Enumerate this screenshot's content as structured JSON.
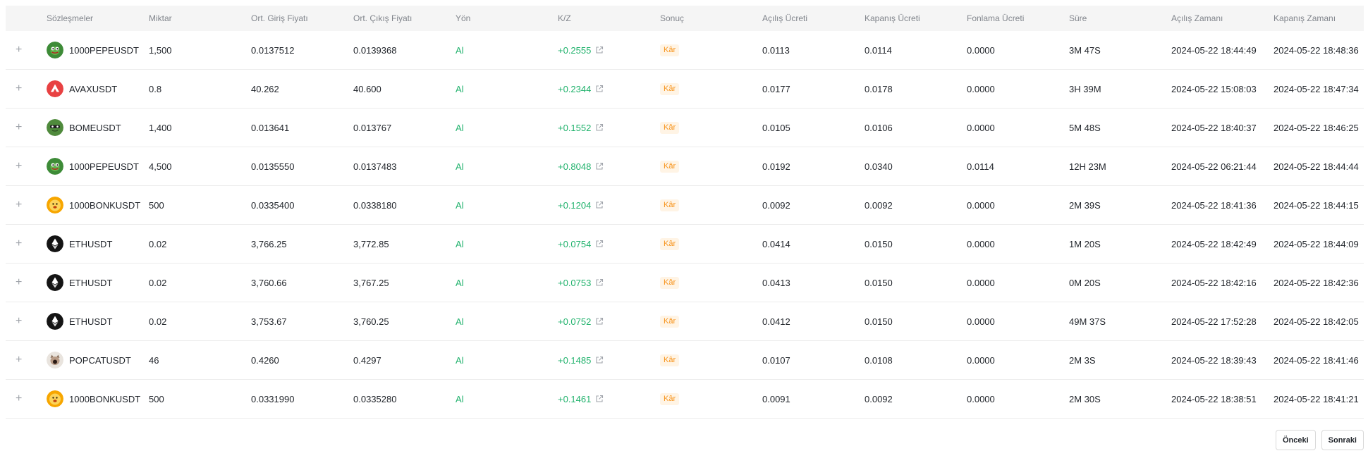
{
  "table": {
    "headers": {
      "symbol": "Sözleşmeler",
      "qty": "Miktar",
      "entry": "Ort. Giriş Fiyatı",
      "exit": "Ort. Çıkış Fiyatı",
      "side": "Yön",
      "pnl": "K/Z",
      "result": "Sonuç",
      "open_fee": "Açılış Ücreti",
      "close_fee": "Kapanış Ücreti",
      "funding_fee": "Fonlama Ücreti",
      "duration": "Süre",
      "open_time": "Açılış Zamanı",
      "close_time": "Kapanış Zamanı"
    },
    "expand_glyph": "+",
    "rows": [
      {
        "coin_icon": "pepe-coin-icon",
        "symbol": "1000PEPEUSDT",
        "qty": "1,500",
        "entry": "0.0137512",
        "exit": "0.0139368",
        "side": "Al",
        "pnl": "+0.2555",
        "result": "Kâr",
        "open_fee": "0.0113",
        "close_fee": "0.0114",
        "funding_fee": "0.0000",
        "duration": "3M 47S",
        "open_time": "2024-05-22 18:44:49",
        "close_time": "2024-05-22 18:48:36"
      },
      {
        "coin_icon": "avax-coin-icon",
        "symbol": "AVAXUSDT",
        "qty": "0.8",
        "entry": "40.262",
        "exit": "40.600",
        "side": "Al",
        "pnl": "+0.2344",
        "result": "Kâr",
        "open_fee": "0.0177",
        "close_fee": "0.0178",
        "funding_fee": "0.0000",
        "duration": "3H 39M",
        "open_time": "2024-05-22 15:08:03",
        "close_time": "2024-05-22 18:47:34"
      },
      {
        "coin_icon": "bome-coin-icon",
        "symbol": "BOMEUSDT",
        "qty": "1,400",
        "entry": "0.013641",
        "exit": "0.013767",
        "side": "Al",
        "pnl": "+0.1552",
        "result": "Kâr",
        "open_fee": "0.0105",
        "close_fee": "0.0106",
        "funding_fee": "0.0000",
        "duration": "5M 48S",
        "open_time": "2024-05-22 18:40:37",
        "close_time": "2024-05-22 18:46:25"
      },
      {
        "coin_icon": "pepe-coin-icon",
        "symbol": "1000PEPEUSDT",
        "qty": "4,500",
        "entry": "0.0135550",
        "exit": "0.0137483",
        "side": "Al",
        "pnl": "+0.8048",
        "result": "Kâr",
        "open_fee": "0.0192",
        "close_fee": "0.0340",
        "funding_fee": "0.0114",
        "duration": "12H 23M",
        "open_time": "2024-05-22 06:21:44",
        "close_time": "2024-05-22 18:44:44"
      },
      {
        "coin_icon": "bonk-coin-icon",
        "symbol": "1000BONKUSDT",
        "qty": "500",
        "entry": "0.0335400",
        "exit": "0.0338180",
        "side": "Al",
        "pnl": "+0.1204",
        "result": "Kâr",
        "open_fee": "0.0092",
        "close_fee": "0.0092",
        "funding_fee": "0.0000",
        "duration": "2M 39S",
        "open_time": "2024-05-22 18:41:36",
        "close_time": "2024-05-22 18:44:15"
      },
      {
        "coin_icon": "eth-coin-icon",
        "symbol": "ETHUSDT",
        "qty": "0.02",
        "entry": "3,766.25",
        "exit": "3,772.85",
        "side": "Al",
        "pnl": "+0.0754",
        "result": "Kâr",
        "open_fee": "0.0414",
        "close_fee": "0.0150",
        "funding_fee": "0.0000",
        "duration": "1M 20S",
        "open_time": "2024-05-22 18:42:49",
        "close_time": "2024-05-22 18:44:09"
      },
      {
        "coin_icon": "eth-coin-icon",
        "symbol": "ETHUSDT",
        "qty": "0.02",
        "entry": "3,760.66",
        "exit": "3,767.25",
        "side": "Al",
        "pnl": "+0.0753",
        "result": "Kâr",
        "open_fee": "0.0413",
        "close_fee": "0.0150",
        "funding_fee": "0.0000",
        "duration": "0M 20S",
        "open_time": "2024-05-22 18:42:16",
        "close_time": "2024-05-22 18:42:36"
      },
      {
        "coin_icon": "eth-coin-icon",
        "symbol": "ETHUSDT",
        "qty": "0.02",
        "entry": "3,753.67",
        "exit": "3,760.25",
        "side": "Al",
        "pnl": "+0.0752",
        "result": "Kâr",
        "open_fee": "0.0412",
        "close_fee": "0.0150",
        "funding_fee": "0.0000",
        "duration": "49M 37S",
        "open_time": "2024-05-22 17:52:28",
        "close_time": "2024-05-22 18:42:05"
      },
      {
        "coin_icon": "popcat-coin-icon",
        "symbol": "POPCATUSDT",
        "qty": "46",
        "entry": "0.4260",
        "exit": "0.4297",
        "side": "Al",
        "pnl": "+0.1485",
        "result": "Kâr",
        "open_fee": "0.0107",
        "close_fee": "0.0108",
        "funding_fee": "0.0000",
        "duration": "2M 3S",
        "open_time": "2024-05-22 18:39:43",
        "close_time": "2024-05-22 18:41:46"
      },
      {
        "coin_icon": "bonk-coin-icon",
        "symbol": "1000BONKUSDT",
        "qty": "500",
        "entry": "0.0331990",
        "exit": "0.0335280",
        "side": "Al",
        "pnl": "+0.1461",
        "result": "Kâr",
        "open_fee": "0.0091",
        "close_fee": "0.0092",
        "funding_fee": "0.0000",
        "duration": "2M 30S",
        "open_time": "2024-05-22 18:38:51",
        "close_time": "2024-05-22 18:41:21"
      }
    ]
  },
  "pagination": {
    "prev_label": "Önceki",
    "next_label": "Sonraki"
  },
  "colors": {
    "profit_green": "#20b26c",
    "badge_orange": "#f7931a",
    "badge_bg": "#fff4e5",
    "header_bg": "#f5f5f5"
  }
}
